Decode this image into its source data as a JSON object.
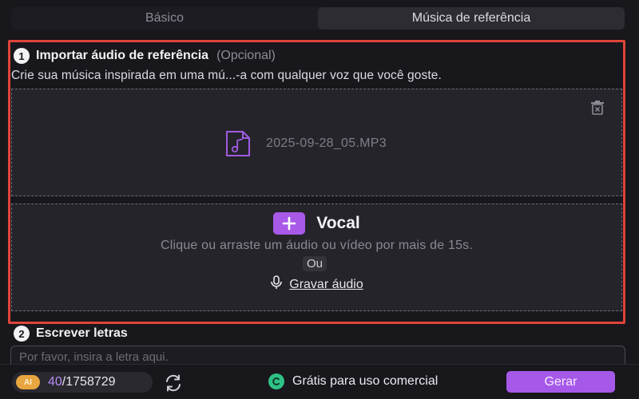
{
  "tabs": {
    "basic": "Básico",
    "reference": "Música de referência",
    "active": "reference"
  },
  "import_section": {
    "step_number": "1",
    "title": "Importar áudio de referência",
    "optional": "(Opcional)",
    "description": "Crie sua música inspirada em uma mú...-a com qualquer voz que você goste."
  },
  "file_zone": {
    "file_name": "2025-09-28_05.MP3",
    "file_icon": "music-file-icon",
    "delete_icon": "trash-icon"
  },
  "vocal_zone": {
    "label": "Vocal",
    "hint": "Clique ou arraste um áudio ou vídeo por mais de 15s.",
    "or_text": "Ou",
    "record_label": "Gravar áudio",
    "record_icon": "microphone-icon"
  },
  "lyrics_section": {
    "step_number": "2",
    "title": "Escrever letras",
    "placeholder": "Por favor, insira a letra aqui."
  },
  "bottom_bar": {
    "ai_badge": "AI",
    "credits_used": "40",
    "credits_total": "/1758729",
    "free_label": "Grátis para uso comercial",
    "generate_label": "Gerar"
  },
  "colors": {
    "accent": "#a659e8",
    "highlight_border": "#e0443a",
    "free_icon": "#2fc187"
  }
}
